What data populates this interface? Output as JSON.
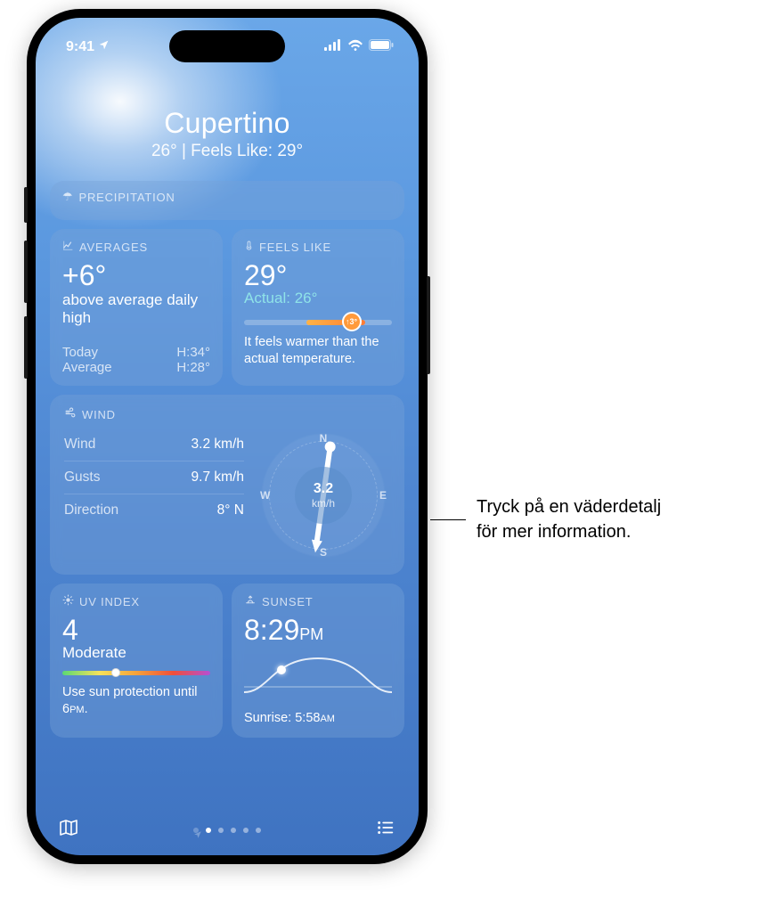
{
  "status": {
    "time": "9:41"
  },
  "header": {
    "city": "Cupertino",
    "temp": "26°",
    "divider": " | ",
    "feels_label": "Feels Like: ",
    "feels_value": "29°"
  },
  "cards": {
    "precipitation": {
      "title": "PRECIPITATION"
    },
    "averages": {
      "title": "AVERAGES",
      "delta": "+6°",
      "desc": "above average daily high",
      "today_label": "Today",
      "today_value": "H:34°",
      "average_label": "Average",
      "average_value": "H:28°"
    },
    "feels_like": {
      "title": "FEELS LIKE",
      "value": "29°",
      "actual_label": "Actual: ",
      "actual_value": "26°",
      "pin": "↑3°",
      "note": "It feels warmer than the actual temperature."
    },
    "wind": {
      "title": "WIND",
      "rows": [
        {
          "label": "Wind",
          "value": "3.2 km/h"
        },
        {
          "label": "Gusts",
          "value": "9.7 km/h"
        },
        {
          "label": "Direction",
          "value": "8° N"
        }
      ],
      "compass": {
        "speed": "3.2",
        "unit": "km/h",
        "n": "N",
        "e": "E",
        "s": "S",
        "w": "W"
      }
    },
    "uv": {
      "title": "UV INDEX",
      "value": "4",
      "level": "Moderate",
      "note_a": "Use sun protection until 6",
      "note_pm": "PM",
      "note_b": "."
    },
    "sunset": {
      "title": "SUNSET",
      "time": "8:29",
      "ampm": "PM",
      "sunrise_label": "Sunrise: ",
      "sunrise_time": "5:58",
      "sunrise_ampm": "AM"
    }
  },
  "callout": {
    "line1": "Tryck på en väderdetalj",
    "line2": "för mer information."
  }
}
